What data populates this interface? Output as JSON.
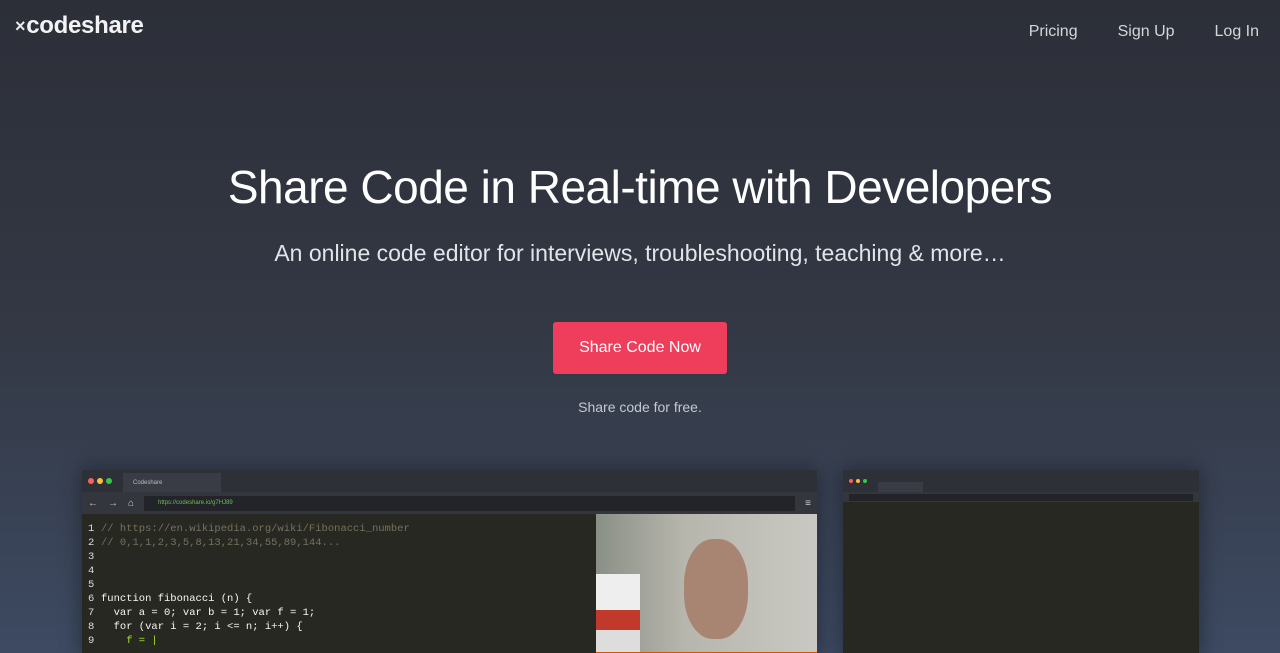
{
  "header": {
    "logo": "codeshare",
    "logo_mark": "×",
    "nav": [
      "Pricing",
      "Sign Up",
      "Log In"
    ]
  },
  "hero": {
    "title": "Share Code in Real-time with Developers",
    "subtitle": "An online code editor for interviews, troubleshooting, teaching & more…",
    "cta": "Share Code Now",
    "note": "Share code for free."
  },
  "preview": {
    "tab": "Codeshare",
    "url": "https://codeshare.io/g7HJ89",
    "code_lines": [
      {
        "n": "1",
        "t": "// https://en.wikipedia.org/wiki/Fibonacci_number"
      },
      {
        "n": "2",
        "t": "// 0,1,1,2,3,5,8,13,21,34,55,89,144..."
      },
      {
        "n": "3",
        "t": ""
      },
      {
        "n": "4",
        "t": ""
      },
      {
        "n": "5",
        "t": ""
      },
      {
        "n": "6",
        "t": "function fibonacci (n) {"
      },
      {
        "n": "7",
        "t": "  var a = 0; var b = 1; var f = 1;"
      },
      {
        "n": "8",
        "t": "  for (var i = 2; i <= n; i++) {"
      },
      {
        "n": "9",
        "t": "    f = |"
      }
    ]
  }
}
